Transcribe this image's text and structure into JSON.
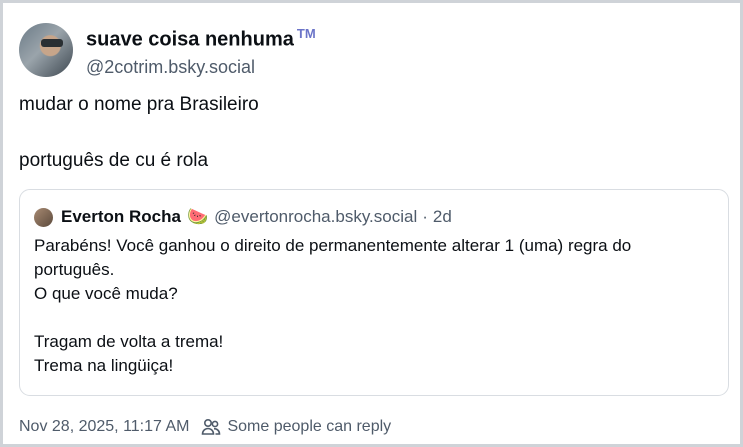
{
  "author": {
    "display_name": "suave coisa nenhuma",
    "badge": "TM",
    "handle": "@2cotrim.bsky.social"
  },
  "post": {
    "lines": [
      "mudar o nome pra Brasileiro",
      "português de cu é rola"
    ]
  },
  "quote": {
    "name": "Everton Rocha",
    "emoji": "🍉",
    "handle": "@evertonrocha.bsky.social",
    "separator": "·",
    "time": "2d",
    "lines": [
      "Parabéns! Você ganhou o direito de permanentemente alterar 1 (uma) regra do português.",
      "O que você muda?",
      "",
      "Tragam de volta a trema!",
      "Trema na lingüiça!"
    ]
  },
  "footer": {
    "timestamp": "Nov 28, 2025, 11:17 AM",
    "reply_setting": "Some people can reply",
    "reply_icon": "people-icon"
  },
  "colors": {
    "text": "#0b0f14",
    "muted": "#4f5b6a",
    "border": "#d9dde2",
    "badge": "#6b74c8"
  }
}
